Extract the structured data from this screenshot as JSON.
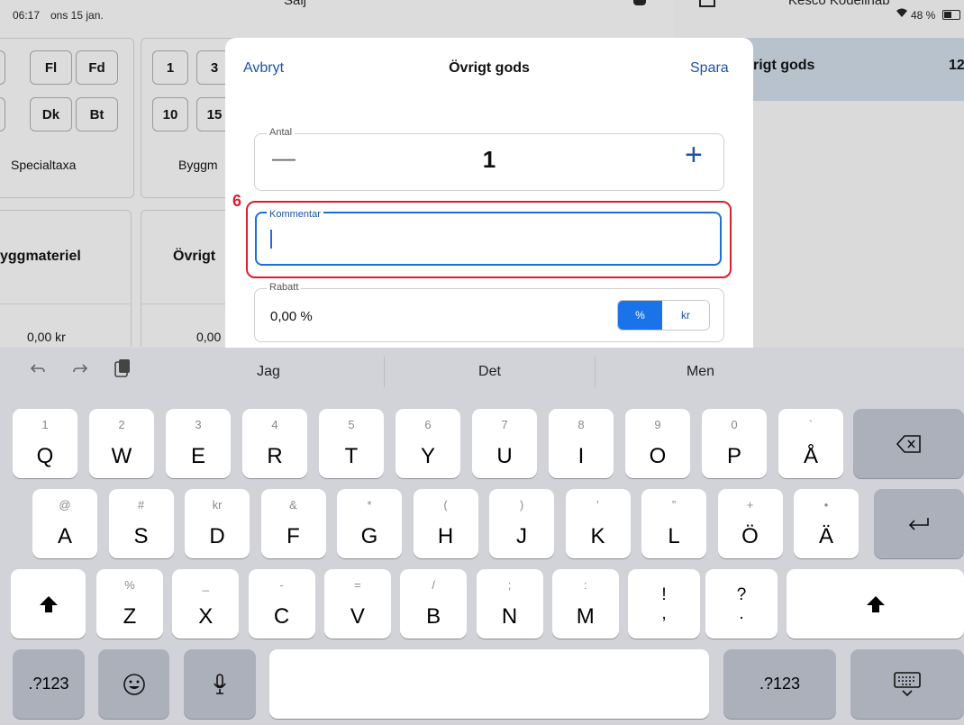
{
  "status_bar": {
    "time": "06:17",
    "date": "ons 15 jan.",
    "battery": "48 %",
    "center_partial": "Salj",
    "right_partial": "Kesco Kodelinab"
  },
  "background": {
    "keys_row1": [
      "Fl",
      "Fd",
      "1",
      "3"
    ],
    "keys_row2": [
      "Dk",
      "Bt",
      "10",
      "15"
    ],
    "tile_labels": [
      "Specialtaxa",
      "Byggm"
    ],
    "tile2_labels": [
      "yggmateriel",
      "Övrigt"
    ],
    "prices": [
      "0,00 kr",
      "0,00"
    ],
    "right_selected": {
      "label": "rigt gods",
      "value": "12"
    }
  },
  "modal": {
    "cancel": "Avbryt",
    "title": "Övrigt gods",
    "save": "Spara",
    "antal": {
      "label": "Antal",
      "value": "1",
      "minus": "—",
      "plus": "+"
    },
    "marker": "6",
    "kommentar": {
      "label": "Kommentar",
      "value": ""
    },
    "rabatt": {
      "label": "Rabatt",
      "value": "0,00 %",
      "options": [
        "%",
        "kr"
      ],
      "selected": "%"
    }
  },
  "keyboard": {
    "suggestions": [
      "Jag",
      "Det",
      "Men"
    ],
    "row1": [
      {
        "main": "Q",
        "sub": "1"
      },
      {
        "main": "W",
        "sub": "2"
      },
      {
        "main": "E",
        "sub": "3"
      },
      {
        "main": "R",
        "sub": "4"
      },
      {
        "main": "T",
        "sub": "5"
      },
      {
        "main": "Y",
        "sub": "6"
      },
      {
        "main": "U",
        "sub": "7"
      },
      {
        "main": "I",
        "sub": "8"
      },
      {
        "main": "O",
        "sub": "9"
      },
      {
        "main": "P",
        "sub": "0"
      },
      {
        "main": "Å",
        "sub": "`"
      }
    ],
    "row2": [
      {
        "main": "A",
        "sub": "@"
      },
      {
        "main": "S",
        "sub": "#"
      },
      {
        "main": "D",
        "sub": "kr"
      },
      {
        "main": "F",
        "sub": "&"
      },
      {
        "main": "G",
        "sub": "*"
      },
      {
        "main": "H",
        "sub": "("
      },
      {
        "main": "J",
        "sub": ")"
      },
      {
        "main": "K",
        "sub": "’"
      },
      {
        "main": "L",
        "sub": "”"
      },
      {
        "main": "Ö",
        "sub": "+"
      },
      {
        "main": "Ä",
        "sub": "•"
      }
    ],
    "row3": [
      {
        "main": "Z",
        "sub": "%"
      },
      {
        "main": "X",
        "sub": "_"
      },
      {
        "main": "C",
        "sub": "-"
      },
      {
        "main": "V",
        "sub": "="
      },
      {
        "main": "B",
        "sub": "/"
      },
      {
        "main": "N",
        "sub": ";"
      },
      {
        "main": "M",
        "sub": ":"
      }
    ],
    "punct1": {
      "top": "!",
      "bottom": ","
    },
    "punct2": {
      "top": "?",
      "bottom": "."
    },
    "numbers_label": ".?123"
  },
  "colors": {
    "accent": "#1a52a8",
    "highlight_red": "#d9202c",
    "focus_blue": "#1e6fd9",
    "segment_active": "#1a73e8"
  }
}
